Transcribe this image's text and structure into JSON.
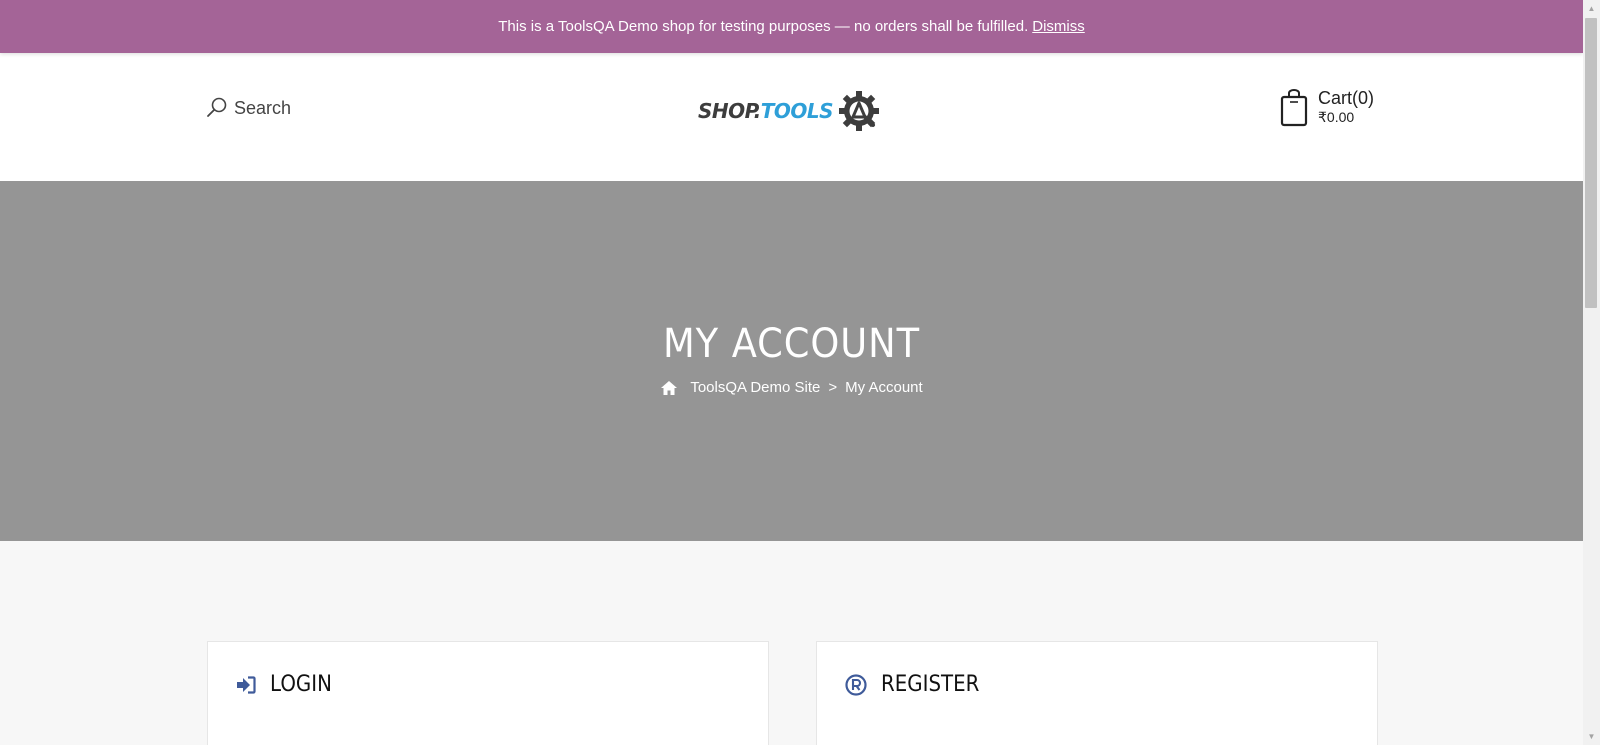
{
  "notice": {
    "text": "This is a ToolsQA Demo shop for testing purposes — no orders shall be fulfilled.",
    "dismiss_label": "Dismiss"
  },
  "header": {
    "search_label": "Search",
    "logo": {
      "part1": "SHOP.",
      "part2": "TOOLS"
    },
    "cart": {
      "label": "Cart(0)",
      "total": "₹0.00"
    }
  },
  "hero": {
    "title": "MY ACCOUNT",
    "breadcrumb": {
      "home": "ToolsQA Demo Site",
      "separator": ">",
      "current": "My Account"
    }
  },
  "sections": {
    "login_title": "LOGIN",
    "register_title": "REGISTER"
  },
  "colors": {
    "notice_bg": "#a46497",
    "hero_bg": "#959595",
    "logo_tools": "#2e9fd8",
    "section_icon": "#3f5b9a"
  },
  "icons": {
    "search": "search-icon",
    "cart": "shopping-bag-icon",
    "home": "home-icon",
    "login": "sign-in-icon",
    "register": "registered-icon",
    "logo": "gear-qa-icon"
  }
}
